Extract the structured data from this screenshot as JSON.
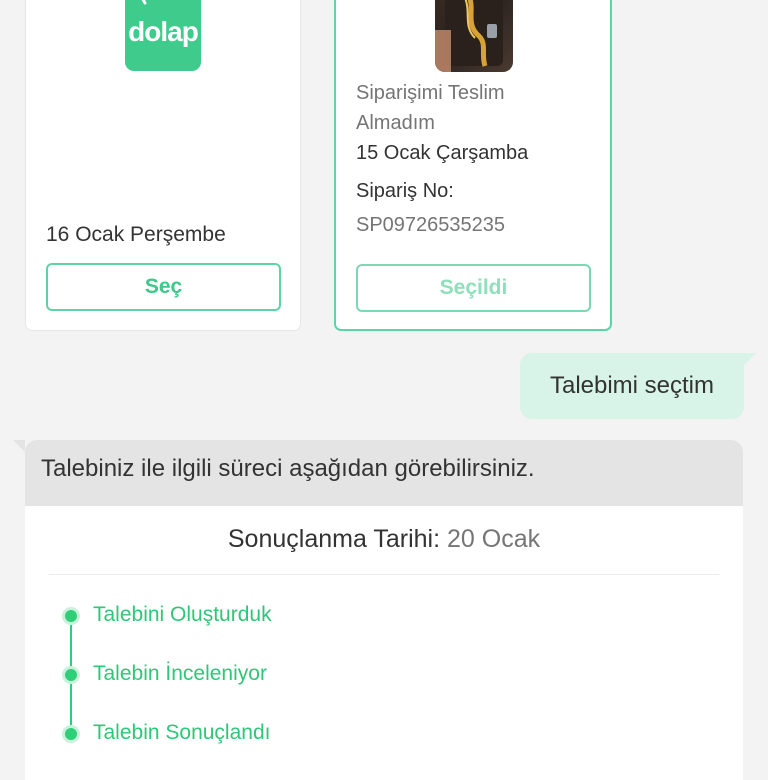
{
  "orders": [
    {
      "logo_text": "dolap",
      "date": "16 Ocak Perşembe",
      "button_label": "Seç"
    },
    {
      "status": "Siparişimi Teslim",
      "status_line2": "Almadım",
      "date": "15 Ocak Çarşamba",
      "order_no_label": "Sipariş No:",
      "order_no": "SP09726535235",
      "button_label": "Seçildi"
    }
  ],
  "user_message": "Talebimi seçtim",
  "bot": {
    "message": "Talebiniz ile ilgili süreci aşağıdan görebilirsiniz.",
    "result_label": "Sonuçlanma Tarihi:",
    "result_date": "20 Ocak",
    "steps": [
      "Talebini Oluşturduk",
      "Talebin İnceleniyor",
      "Talebin Sonuçlandı"
    ]
  },
  "colors": {
    "accent_green": "#3ec889",
    "selected_border": "#5fd3a4",
    "user_bubble": "#d8f3e8",
    "bot_header": "#e4e4e4",
    "timeline_green": "#2ecf78"
  },
  "icons": [
    "dolap-logo",
    "product-thumbnail"
  ]
}
